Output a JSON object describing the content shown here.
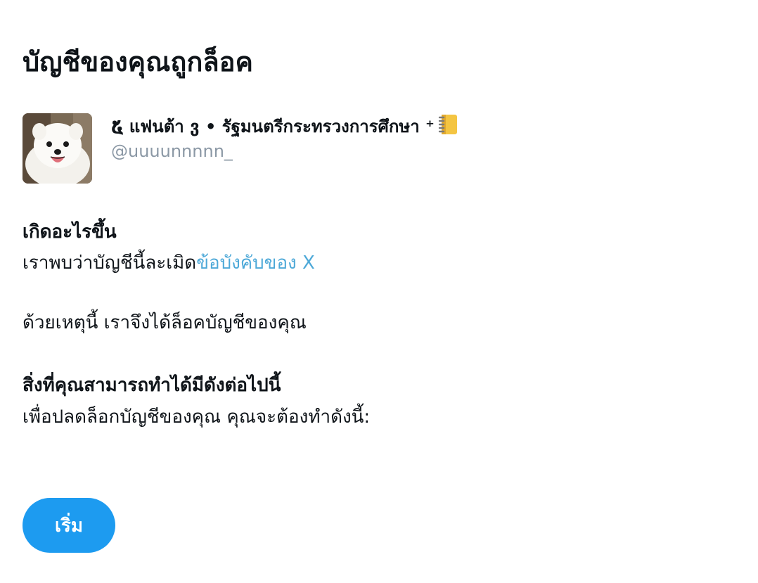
{
  "header": {
    "title": "บัญชีของคุณถูกล็อค"
  },
  "account": {
    "display_name": "໕ แฟนต้า ვ • รัฐมนตรีกระทรวงการศึกษา ⁺",
    "name_emoji_icon": "notebook-icon",
    "handle": "@uuuunnnnn_",
    "avatar": "white-pomeranian-dog-photo"
  },
  "what_happened": {
    "heading": "เกิดอะไรขึ้น",
    "text_before_link": "เราพบว่าบัญชีนี้ละเมิด",
    "link_label": "ข้อบังคับของ X",
    "reason": "ด้วยเหตุนี้ เราจึงได้ล็อคบัญชีของคุณ"
  },
  "what_you_can_do": {
    "heading": "สิ่งที่คุณสามารถทำได้มีดังต่อไปนี้",
    "text": "เพื่อปลดล็อกบัญชีของคุณ คุณจะต้องทำดังนี้:"
  },
  "actions": {
    "start_label": "เริ่ม"
  },
  "colors": {
    "link": "#4ea9d8",
    "primary_button": "#1d9bf0",
    "secondary_text": "#8b98a5",
    "text": "#0f1419"
  }
}
